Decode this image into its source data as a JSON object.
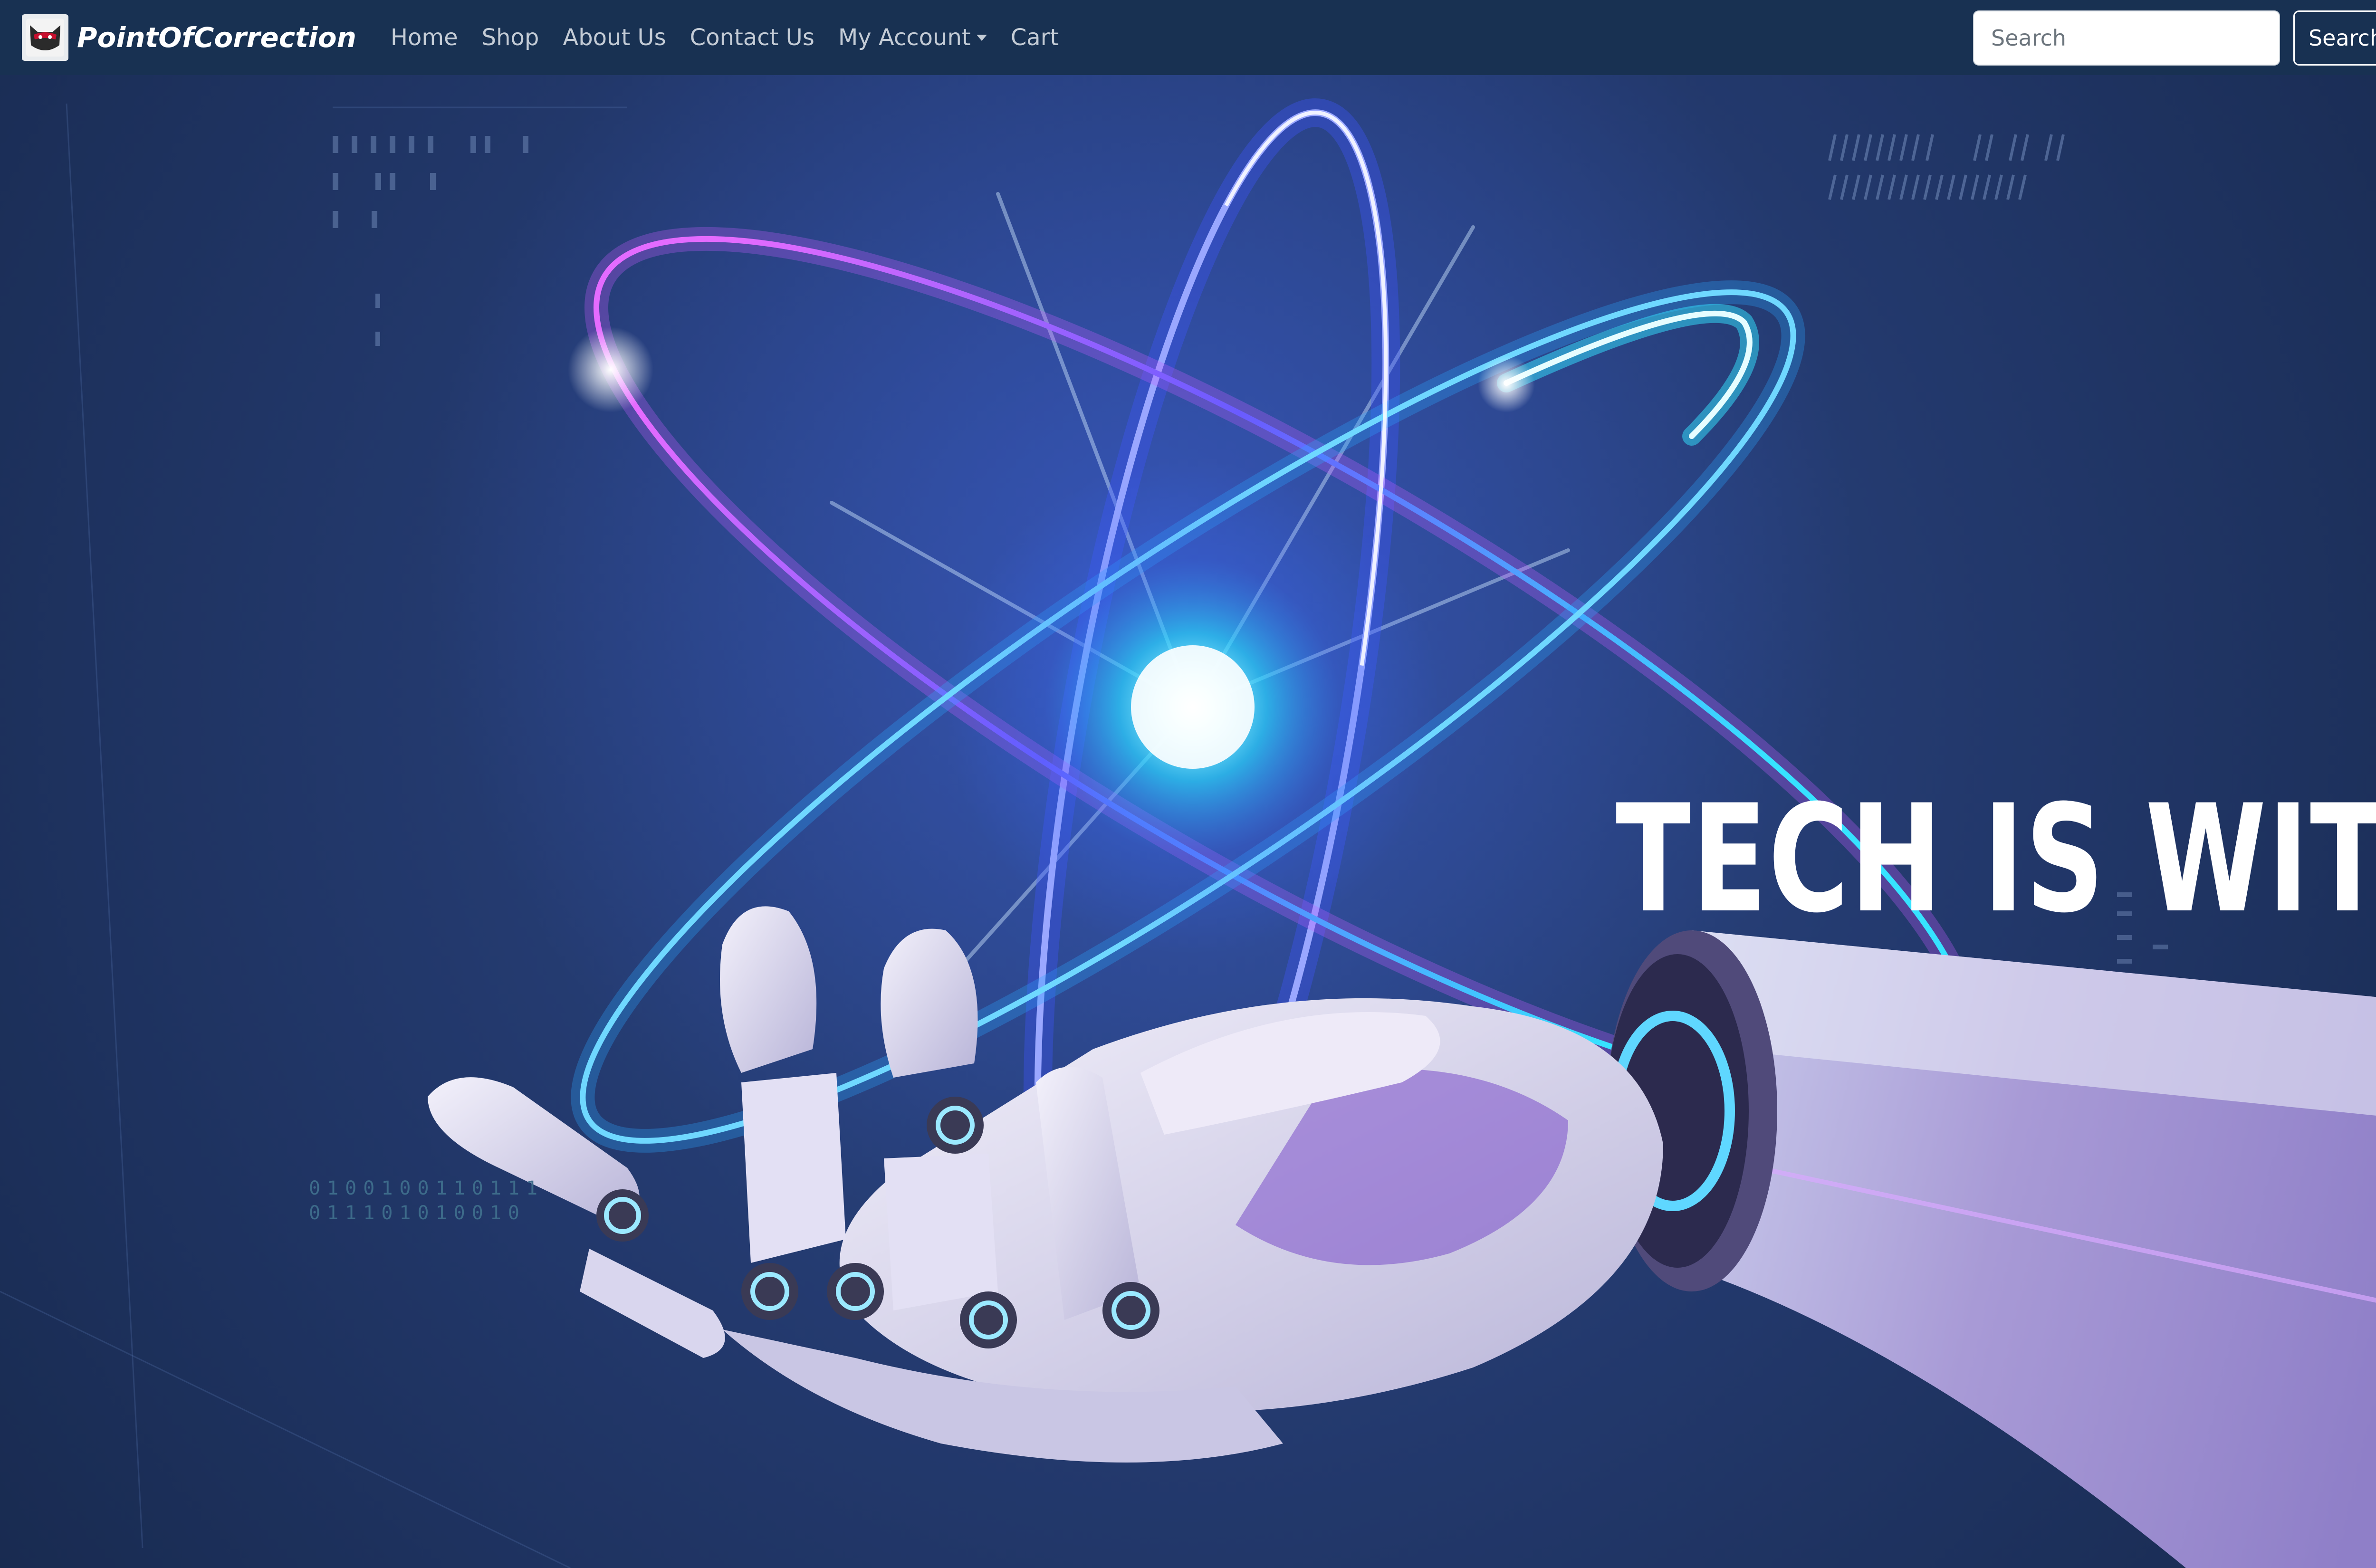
{
  "brand": {
    "name": "PointOfCorrection",
    "logo_icon": "ninja-mask-icon"
  },
  "nav": {
    "items": [
      {
        "label": "Home"
      },
      {
        "label": "Shop"
      },
      {
        "label": "About Us"
      },
      {
        "label": "Contact Us"
      },
      {
        "label": "My Account",
        "dropdown": true
      },
      {
        "label": "Cart"
      }
    ]
  },
  "search": {
    "placeholder": "Search",
    "button_label": "Search"
  },
  "hero": {
    "tagline": "TECH IS WITHIN",
    "binary_lines": [
      "0100100110111",
      "011101010010"
    ]
  },
  "colors": {
    "navbar_bg": "#183152",
    "hero_bg": "#1a2b55",
    "accent_cyan": "#34e4ff",
    "accent_magenta": "#d85bff",
    "text_light": "#ffffff",
    "nav_link": "#c4ccd6"
  }
}
